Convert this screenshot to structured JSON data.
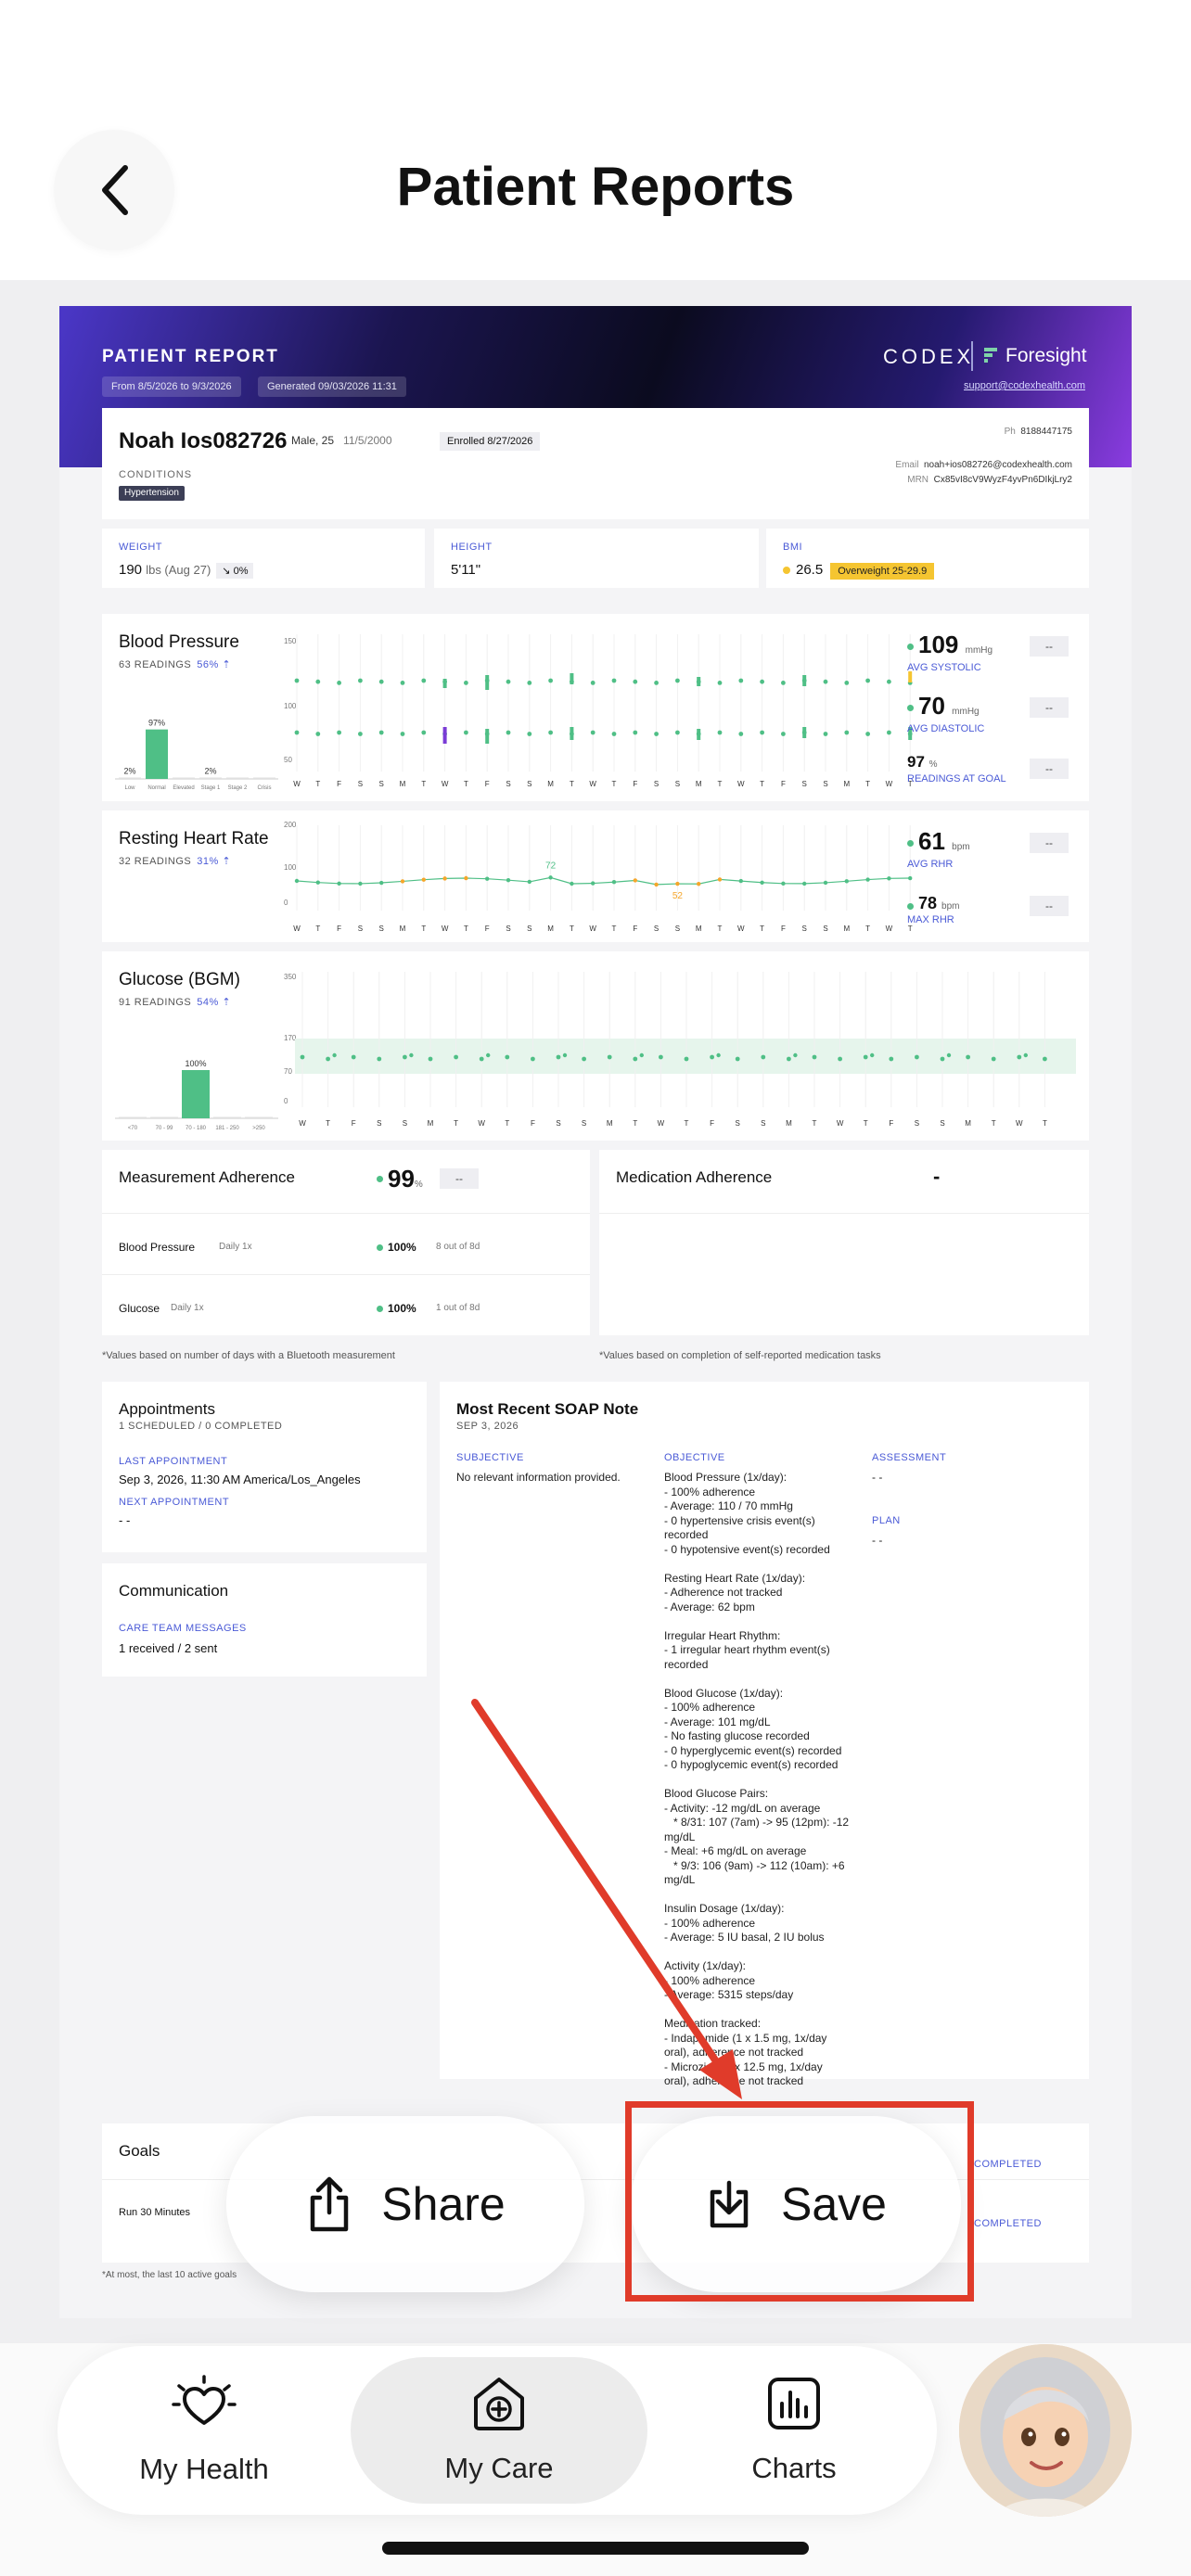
{
  "header": {
    "title": "Patient Reports"
  },
  "report": {
    "banner": {
      "title": "PATIENT REPORT",
      "date_range": "From 8/5/2026 to 9/3/2026",
      "generated": "Generated 09/03/2026 11:31",
      "brand": "CODEX",
      "product": "Foresight",
      "support_email": "support@codexhealth.com"
    },
    "patient": {
      "name": "Noah Ios082726",
      "sex_age": "Male, 25",
      "dob": "11/5/2000",
      "enrolled": "Enrolled 8/27/2026",
      "conditions_label": "CONDITIONS",
      "condition": "Hypertension",
      "ph_label": "Ph",
      "phone": "8188447175",
      "email_label": "Email",
      "email": "noah+ios082726@codexhealth.com",
      "mrn_label": "MRN",
      "mrn": "Cx85vI8cV9WyzF4yvPn6DIkjLry2"
    },
    "weight": {
      "label": "WEIGHT",
      "value": "190",
      "unit": "lbs (Aug 27)",
      "change": "↘ 0%"
    },
    "height": {
      "label": "HEIGHT",
      "value": "5'11\""
    },
    "bmi": {
      "label": "BMI",
      "value": "26.5",
      "category": "Overweight 25-29.9"
    },
    "blood_pressure": {
      "title": "Blood Pressure",
      "readings": "63 READINGS",
      "pct": "56% ⇡",
      "hist": [
        {
          "label": "Low",
          "pct": 2,
          "text": "2%"
        },
        {
          "label": "Normal",
          "pct": 97,
          "text": "97%"
        },
        {
          "label": "Elevated",
          "pct": 0,
          "text": ""
        },
        {
          "label": "Stage 1",
          "pct": 2,
          "text": "2%"
        },
        {
          "label": "Stage 2",
          "pct": 0,
          "text": ""
        },
        {
          "label": "Crisis",
          "pct": 0,
          "text": ""
        }
      ],
      "y_ticks": [
        "150",
        "100",
        "50"
      ],
      "systolic": "109",
      "systolic_unit": "mmHg",
      "systolic_label": "AVG SYSTOLIC",
      "diastolic": "70",
      "diastolic_unit": "mmHg",
      "diastolic_label": "AVG DIASTOLIC",
      "goal": "97",
      "goal_unit": "%",
      "goal_label": "READINGS AT GOAL",
      "btn": "--"
    },
    "heart_rate": {
      "title": "Resting Heart Rate",
      "readings": "32 READINGS",
      "pct": "31% ⇡",
      "y_ticks": [
        "200",
        "100",
        "0"
      ],
      "peak": "72",
      "low": "52",
      "avg": "61",
      "avg_unit": "bpm",
      "avg_label": "AVG RHR",
      "max": "78",
      "max_unit": "bpm",
      "max_label": "MAX RHR",
      "btn": "--"
    },
    "glucose": {
      "title": "Glucose (BGM)",
      "readings": "91 READINGS",
      "pct": "54% ⇡",
      "y_ticks": [
        "350",
        "170",
        "70",
        "0"
      ],
      "hist_top": "100%",
      "hist_labels": [
        "<70",
        "70 - 99",
        "70 - 180",
        "181 - 250",
        ">250"
      ]
    },
    "day_letters": [
      "W",
      "T",
      "F",
      "S",
      "S",
      "M",
      "T",
      "W",
      "T",
      "F",
      "S",
      "S",
      "M",
      "T",
      "W",
      "T",
      "F",
      "S",
      "S",
      "M",
      "T",
      "W",
      "T",
      "F",
      "S",
      "S",
      "M",
      "T",
      "W",
      "T"
    ],
    "measurement": {
      "title": "Measurement Adherence",
      "value": "99",
      "unit": "%",
      "btn": "--",
      "rows": [
        {
          "name": "Blood Pressure",
          "freq": "Daily 1x",
          "pct": "100%",
          "detail": "8 out of 8d"
        },
        {
          "name": "Glucose",
          "freq": "Daily 1x",
          "pct": "100%",
          "detail": "1 out of 8d"
        }
      ],
      "note": "*Values based on number of days with a Bluetooth measurement"
    },
    "medication": {
      "title": "Medication Adherence",
      "value": "-",
      "note": "*Values based on completion of self-reported medication tasks"
    },
    "appointments": {
      "title": "Appointments",
      "sub": "1 SCHEDULED / 0 COMPLETED",
      "last_label": "LAST APPOINTMENT",
      "last": "Sep 3, 2026, 11:30 AM America/Los_Angeles",
      "next_label": "NEXT APPOINTMENT",
      "next": "- -"
    },
    "communication": {
      "title": "Communication",
      "label": "CARE TEAM MESSAGES",
      "value": "1 received / 2 sent"
    },
    "soap": {
      "title": "Most Recent SOAP Note",
      "date": "SEP 3, 2026",
      "subjective_label": "SUBJECTIVE",
      "subjective": "No relevant information provided.",
      "objective_label": "OBJECTIVE",
      "objective": "Blood Pressure (1x/day):\n- 100% adherence\n- Average: 110 / 70 mmHg\n- 0 hypertensive crisis event(s)\nrecorded\n- 0 hypotensive event(s) recorded\n\nResting Heart Rate (1x/day):\n- Adherence not tracked\n- Average: 62 bpm\n\nIrregular Heart Rhythm:\n- 1 irregular heart rhythm event(s)\nrecorded\n\nBlood Glucose (1x/day):\n- 100% adherence\n- Average: 101 mg/dL\n- No fasting glucose recorded\n- 0 hyperglycemic event(s) recorded\n- 0 hypoglycemic event(s) recorded\n\nBlood Glucose Pairs:\n- Activity: -12 mg/dL on average\n   * 8/31: 107 (7am) -> 95 (12pm): -12\nmg/dL\n- Meal: +6 mg/dL on average\n   * 9/3: 106 (9am) -> 112 (10am): +6\nmg/dL\n\nInsulin Dosage (1x/day):\n- 100% adherence\n- Average: 5 IU basal, 2 IU bolus\n\nActivity (1x/day):\n- 100% adherence\n- Average: 5315 steps/day\n\nMedication tracked:\n- Indapamide (1 x 1.5 mg, 1x/day\noral), adherence not tracked\n- Microzide (1 x 12.5 mg, 1x/day\noral), adherence not tracked",
      "assessment_label": "ASSESSMENT",
      "assessment": "- -",
      "plan_label": "PLAN",
      "plan": "- -"
    },
    "goals": {
      "title": "Goals",
      "row": "Run 30 Minutes",
      "status1": "COMPLETED",
      "status2": "COMPLETED",
      "note": "*At most, the last 10 active goals"
    }
  },
  "actions": {
    "share": "Share",
    "save": "Save"
  },
  "tabs": [
    {
      "label": "My Health"
    },
    {
      "label": "My Care"
    },
    {
      "label": "Charts"
    }
  ],
  "colors": {
    "accent_blue": "#4a5ad6",
    "green": "#4fbf86",
    "highlight_red": "#e03b2a",
    "bmi_yellow": "#f5c531"
  }
}
